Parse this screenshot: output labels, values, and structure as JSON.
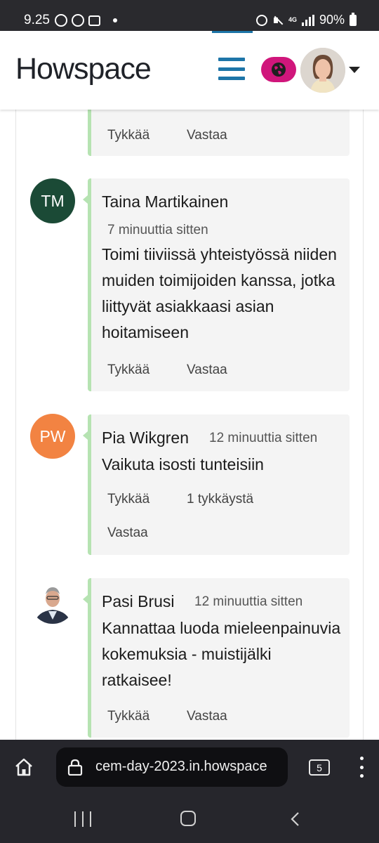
{
  "status_bar": {
    "time": "9.25",
    "battery": "90%",
    "network": "4G"
  },
  "header": {
    "logo": "Howspace",
    "accent_color": "#1d75a8",
    "globe_color": "#d0167b"
  },
  "comments": [
    {
      "name": "",
      "time": "",
      "text": "",
      "like_label": "Tykkää",
      "reply_label": "Vastaa"
    },
    {
      "initials": "TM",
      "avatar_color": "#1b4a36",
      "name": "Taina Martikainen",
      "time": "7 minuuttia sitten",
      "text": "Toimi tiiviissä yhteistyössä niiden muiden toimijoiden kanssa, jotka liittyvät asiakkaasi asian hoitamiseen",
      "like_label": "Tykkää",
      "reply_label": "Vastaa"
    },
    {
      "initials": "PW",
      "avatar_color": "#f28342",
      "name": "Pia Wikgren",
      "time": "12 minuuttia sitten",
      "text": "Vaikuta isosti tunteisiin",
      "like_label": "Tykkää",
      "like_count": "1 tykkäystä",
      "reply_label": "Vastaa"
    },
    {
      "name": "Pasi Brusi",
      "time": "12 minuuttia sitten",
      "text": "Kannattaa luoda mieleenpainuvia kokemuksia - muistijälki ratkaisee!",
      "like_label": "Tykkää",
      "reply_label": "Vastaa"
    }
  ],
  "browser": {
    "url": "cem-day-2023.in.howspace",
    "tab_count": "5"
  }
}
